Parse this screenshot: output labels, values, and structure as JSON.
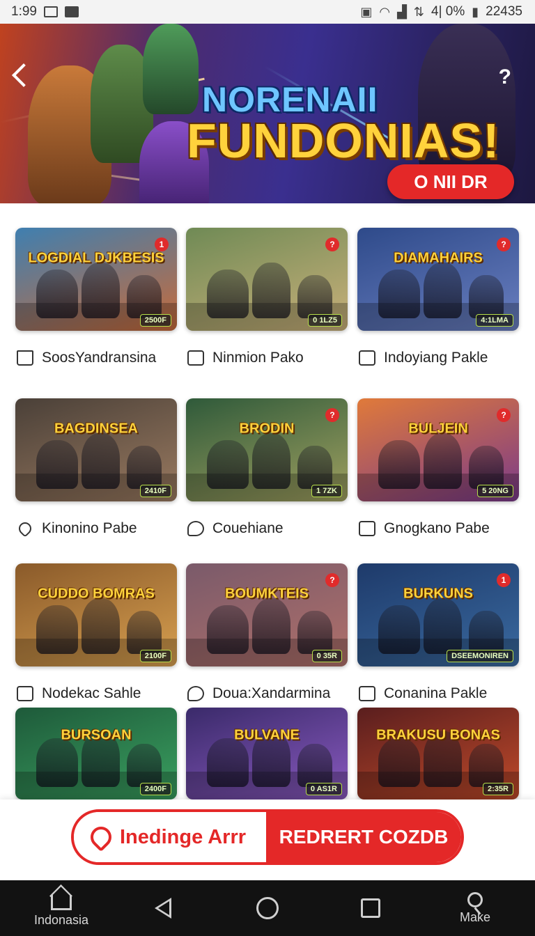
{
  "status_bar": {
    "time": "1:99",
    "battery_text": "4| 0%",
    "clock_right": "22435"
  },
  "hero": {
    "title_line1": "NORENAII",
    "title_line2": "FUNDONIAS!",
    "cta_label": "O NII DR",
    "share_glyph": "?"
  },
  "colors": {
    "accent_red": "#e42828",
    "badge_red": "#e02b2b",
    "price_green": "#b8e04a",
    "nav_bg": "#121212"
  },
  "games": [
    {
      "thumb_title": "LOGDIAL DJKBESIS",
      "badge": "1",
      "price": "2500F",
      "name": "SoosYandransina",
      "icon": "house-icon"
    },
    {
      "thumb_title": "",
      "badge": "?",
      "price": "0 1LZ5",
      "name": "Ninmion Pako",
      "icon": "bag-icon"
    },
    {
      "thumb_title": "DIAMAHAIRS",
      "badge": "?",
      "price": "4:1LMA",
      "name": "Indoyiang Pakle",
      "icon": "bag-icon"
    },
    {
      "thumb_title": "BAGDINSEA",
      "badge": "",
      "price": "2410F",
      "name": "Kinonino Pabe",
      "icon": "heart-icon"
    },
    {
      "thumb_title": "BRODIN",
      "badge": "?",
      "price": "1 7ZK",
      "name": "Couehiane",
      "icon": "chat-icon"
    },
    {
      "thumb_title": "BULJEIN",
      "badge": "?",
      "price": "5 20NG",
      "name": "Gnogkano Pabe",
      "icon": "edit-icon"
    },
    {
      "thumb_title": "CUDDO BOMRAS",
      "badge": "",
      "price": "2100F",
      "name": "Nodekac Sahle",
      "icon": "bag-icon"
    },
    {
      "thumb_title": "BOUMKTEIS",
      "badge": "?",
      "price": "0 35R",
      "name": "Doua:Xandarmina",
      "icon": "chat-icon"
    },
    {
      "thumb_title": "BURKUNS",
      "badge": "1",
      "price": "DSEEMONIREN",
      "name": "Conanina Pakle",
      "icon": "edit-icon"
    },
    {
      "thumb_title": "BURSOAN",
      "badge": "",
      "price": "2400F",
      "name": "",
      "icon": ""
    },
    {
      "thumb_title": "BULVANE",
      "badge": "",
      "price": "0 AS1R",
      "name": "",
      "icon": ""
    },
    {
      "thumb_title": "BRAKUSU BONAS",
      "badge": "",
      "price": "2:35R",
      "name": "",
      "icon": ""
    }
  ],
  "bottom_cta": {
    "left_label": "Inedinge Arrr",
    "right_label": "REDRERT COZDB"
  },
  "navbar": {
    "left_label": "Indonasia",
    "right_label": "Make"
  }
}
